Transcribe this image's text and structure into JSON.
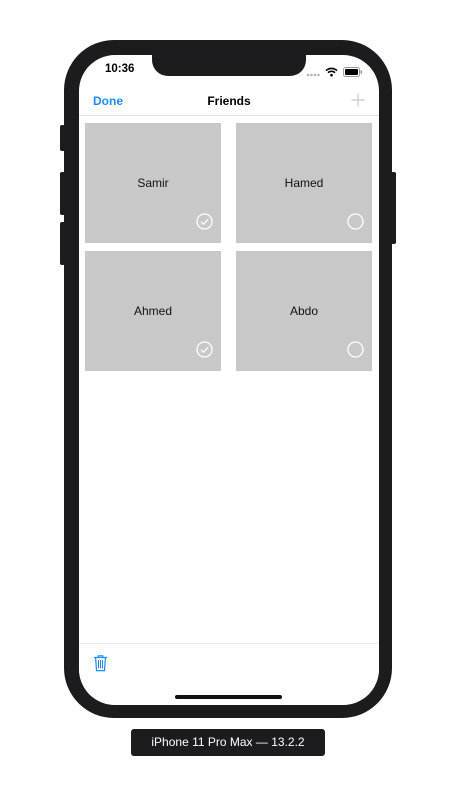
{
  "status_bar": {
    "time": "10:36"
  },
  "nav": {
    "left_button": "Done",
    "title": "Friends",
    "right_icon": "plus-icon"
  },
  "friends": [
    {
      "name": "Samir",
      "selected": true
    },
    {
      "name": "Hamed",
      "selected": false
    },
    {
      "name": "Ahmed",
      "selected": true
    },
    {
      "name": "Abdo",
      "selected": false
    }
  ],
  "toolbar": {
    "icon": "trash-icon"
  },
  "device_label": "iPhone 11 Pro Max — 13.2.2",
  "colors": {
    "accent": "#1a8cff",
    "cell": "#c8c8c8",
    "bezel": "#1c1c1e"
  }
}
